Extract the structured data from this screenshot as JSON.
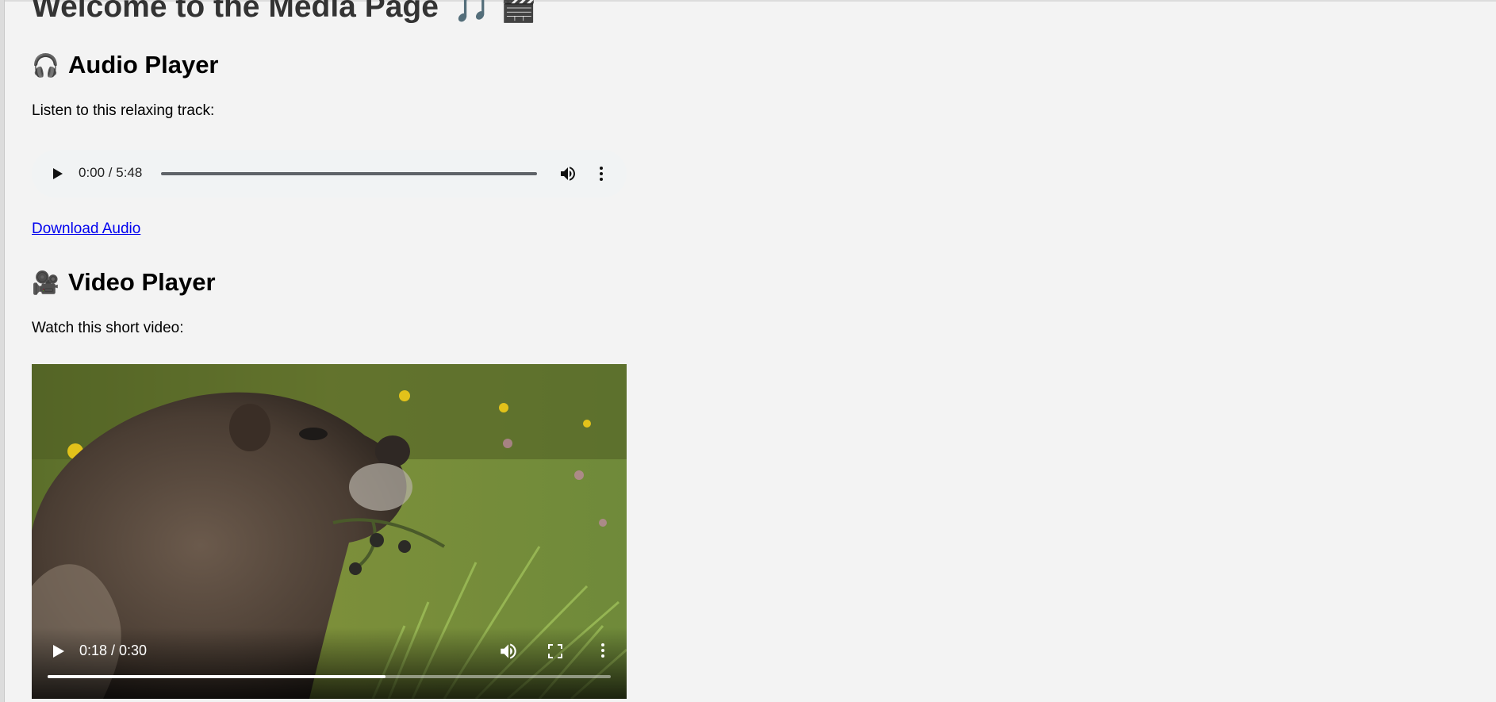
{
  "page": {
    "title": "Welcome to the Media Page",
    "title_emoji": "🎵 🎬"
  },
  "audio_section": {
    "icon": "🎧",
    "heading": "Audio Player",
    "description": "Listen to this relaxing track:",
    "player": {
      "time": "0:00 / 5:48",
      "progress": 0,
      "icons": [
        "play-icon",
        "volume-icon",
        "more-options-icon"
      ]
    },
    "download_label": "Download Audio"
  },
  "video_section": {
    "icon": "🎥",
    "heading": "Video Player",
    "description": "Watch this short video:",
    "player": {
      "time": "0:18 / 0:30",
      "progress": 0.6,
      "icons": [
        "play-icon",
        "volume-icon",
        "fullscreen-icon",
        "more-options-icon"
      ]
    }
  },
  "colors": {
    "background": "#f3f3f3",
    "link": "#0000ee",
    "title": "#333333"
  }
}
